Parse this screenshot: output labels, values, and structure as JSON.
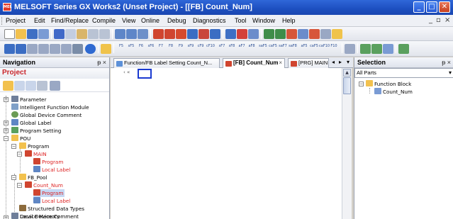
{
  "window": {
    "app_icon": "MEL",
    "title": "MELSOFT Series GX Works2 (Unset Project) - [[FB] Count_Num]",
    "minimize": "_",
    "maximize": "□",
    "close": "✕"
  },
  "menu": {
    "items": [
      "Project",
      "Edit",
      "Find/Replace",
      "Compile",
      "View",
      "Online",
      "Debug",
      "Diagnostics",
      "Tool",
      "Window",
      "Help"
    ],
    "mdi_min": "_",
    "mdi_restore": "▫",
    "mdi_close": "×"
  },
  "toolbar2": {
    "fkeys": [
      "F5",
      "sF5",
      "F6",
      "sF6",
      "F7",
      "F8",
      "F9",
      "sF9",
      "cF9",
      "cF10",
      "sF7",
      "sF8",
      "aF7",
      "aF8",
      "saF5",
      "caF5",
      "saF7",
      "saF8",
      "aF5",
      "caF5",
      "caF10",
      "F10"
    ]
  },
  "navigation": {
    "header": "Navigation",
    "pin": "ᵽ ×",
    "project_label": "Project",
    "tree": [
      {
        "label": "Parameter",
        "red": false
      },
      {
        "label": "Intelligent Function Module",
        "red": false
      },
      {
        "label": "Global Device Comment",
        "red": false
      },
      {
        "label": "Global Label",
        "red": false
      },
      {
        "label": "Program Setting",
        "red": false
      },
      {
        "label": "POU",
        "red": false
      },
      {
        "label": "Program",
        "red": false
      },
      {
        "label": "MAIN",
        "red": true
      },
      {
        "label": "Program",
        "red": true
      },
      {
        "label": "Local Label",
        "red": true
      },
      {
        "label": "FB_Pool",
        "red": false
      },
      {
        "label": "Count_Num",
        "red": true
      },
      {
        "label": "Program",
        "red": true,
        "selected": true
      },
      {
        "label": "Local Label",
        "red": true
      },
      {
        "label": "Structured Data Types",
        "red": false
      },
      {
        "label": "Local Device Comment",
        "red": false
      },
      {
        "label": "Device Memory",
        "red": false
      }
    ]
  },
  "tabs": {
    "items": [
      {
        "label": "Function/FB Label Setting Count_N...",
        "active": false
      },
      {
        "label": "[FB] Count_Num",
        "active": true,
        "close": "×"
      },
      {
        "label": "[PRG] MAIN",
        "active": false
      }
    ],
    "scroll_left": "◂",
    "scroll_right": "▸",
    "menu": "▾"
  },
  "editor": {
    "collapse_glyph": "‹ «"
  },
  "selection": {
    "header": "Selection",
    "pin": "ᵽ ×",
    "dropdown_value": "All Parts",
    "tree": [
      {
        "label": "Function Block"
      },
      {
        "label": "Count_Num"
      }
    ]
  },
  "colors": {
    "title_bar": "#1d4fc0",
    "project_red": "#c8242a",
    "tree_red": "#dd2222",
    "cursor_blue": "#1a3ad0"
  }
}
